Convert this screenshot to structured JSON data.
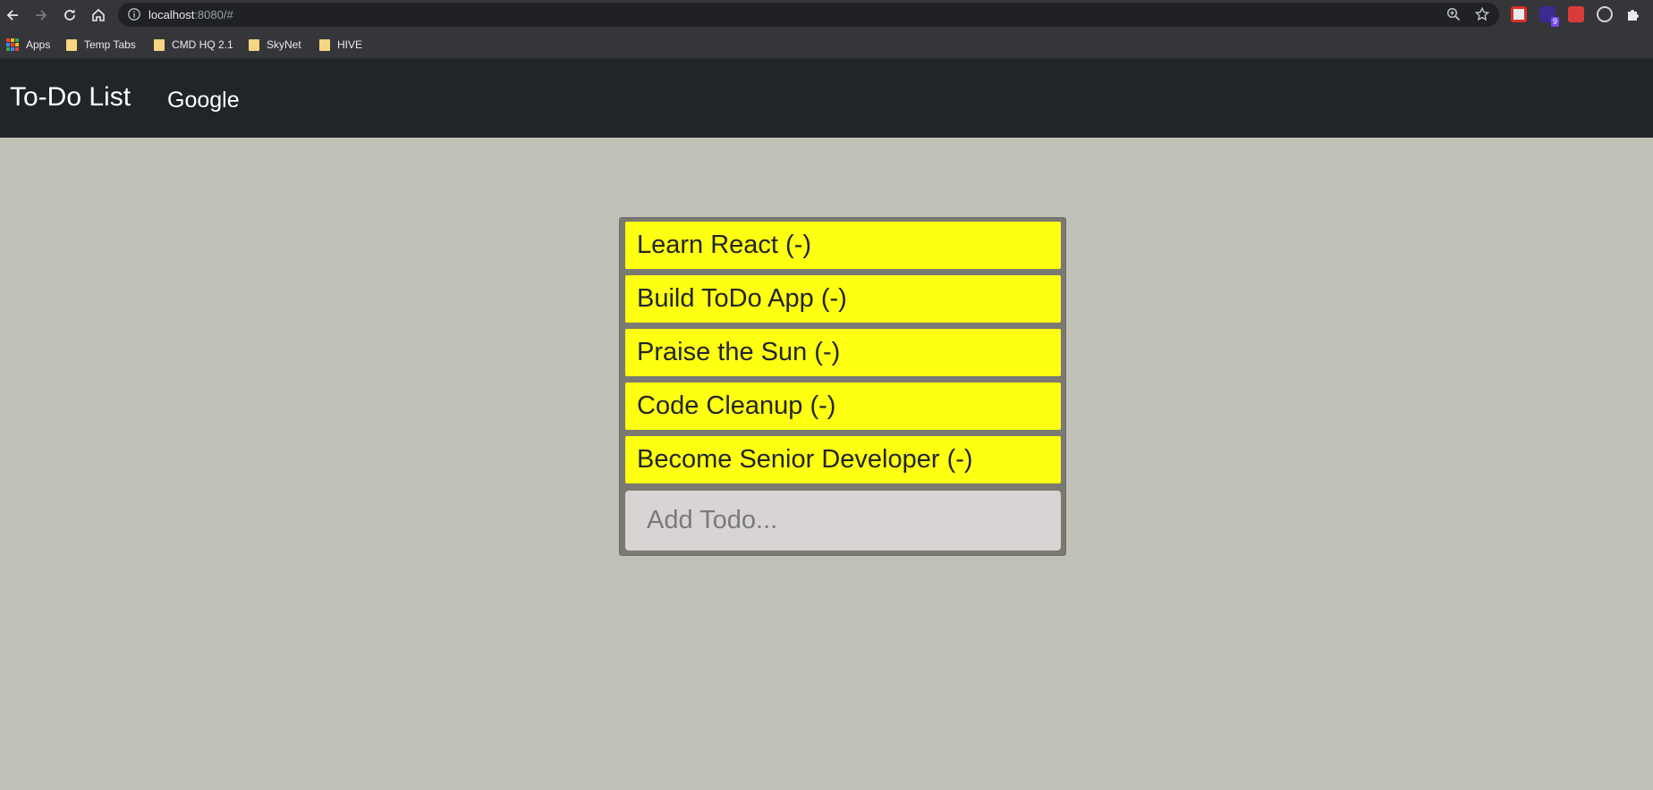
{
  "browser": {
    "url_host": "localhost",
    "url_rest": ":8080/#",
    "bookmarks": [
      {
        "label": "Apps"
      },
      {
        "label": "Temp Tabs"
      },
      {
        "label": "CMD HQ 2.1"
      },
      {
        "label": "SkyNet"
      },
      {
        "label": "HIVE"
      }
    ],
    "extension_badge": "9"
  },
  "navbar": {
    "brand": "To-Do List",
    "link": "Google"
  },
  "todos": [
    {
      "text": "Learn React (-)"
    },
    {
      "text": "Build ToDo App (-)"
    },
    {
      "text": "Praise the Sun (-)"
    },
    {
      "text": "Code Cleanup (-)"
    },
    {
      "text": "Become Senior Developer (-)"
    }
  ],
  "add_todo": {
    "placeholder": "Add Todo...",
    "value": ""
  },
  "colors": {
    "page_bg": "#c0c0b7",
    "navbar_bg": "#212529",
    "todo_item_bg": "#ffff11",
    "panel_bg": "#7a7a72",
    "input_bg": "#d8d4d4"
  }
}
